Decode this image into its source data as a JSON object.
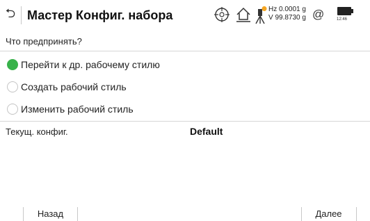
{
  "header": {
    "back_glyph": "⮌",
    "title": "Мастер Конфиг. набора",
    "hz_reading": "Hz 0.0001 g",
    "v_reading": "V  99.8730 g",
    "at_symbol": "@",
    "time": "12:46",
    "icons": [
      "crosshair-icon",
      "home-icon",
      "instrument-icon",
      "battery-icon"
    ],
    "warning_color": "#f5a623"
  },
  "question": "Что предпринять?",
  "options": [
    {
      "label": "Перейти к др. рабочему стилю",
      "selected": true
    },
    {
      "label": "Создать рабочий стиль",
      "selected": false
    },
    {
      "label": "Изменить рабочий стиль",
      "selected": false
    }
  ],
  "config": {
    "label": "Текущ. конфиг.",
    "value": "Default"
  },
  "softkeys": {
    "back": "Назад",
    "next": "Далее"
  },
  "colors": {
    "accent": "#38b24a"
  }
}
